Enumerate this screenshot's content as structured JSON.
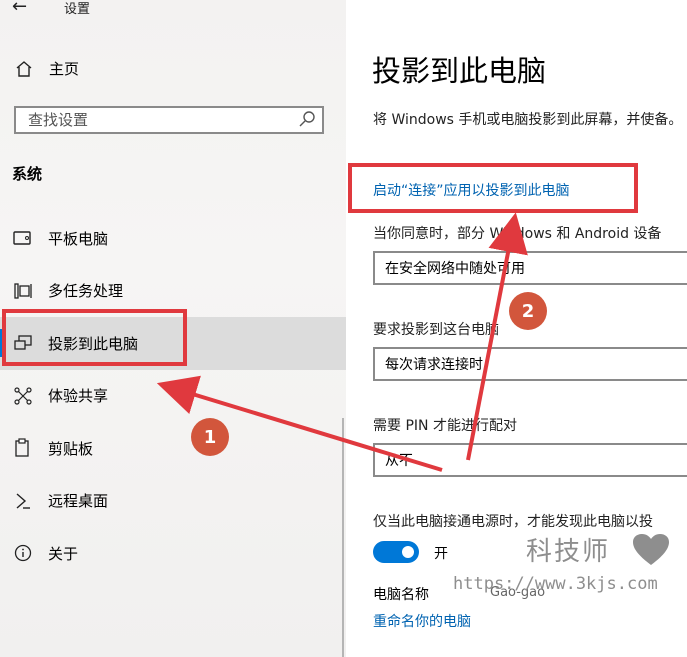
{
  "window": {
    "title": "设置"
  },
  "sidebar": {
    "home_label": "主页",
    "search_placeholder": "查找设置",
    "section_title": "系统",
    "items": [
      {
        "label": "平板电脑",
        "icon": "tablet-icon"
      },
      {
        "label": "多任务处理",
        "icon": "multitask-icon"
      },
      {
        "label": "投影到此电脑",
        "icon": "project-icon",
        "selected": true
      },
      {
        "label": "体验共享",
        "icon": "share-icon"
      },
      {
        "label": "剪贴板",
        "icon": "clipboard-icon"
      },
      {
        "label": "远程桌面",
        "icon": "remote-desktop-icon"
      },
      {
        "label": "关于",
        "icon": "info-icon"
      }
    ]
  },
  "main": {
    "title": "投影到此电脑",
    "description": "将 Windows 手机或电脑投影到此屏幕，并使备。",
    "launch_link": "启动“连接”应用以投影到此电脑",
    "consent_label": "当你同意时，部分 Windows 和 Android 设备",
    "availability_value": "在安全网络中随处可用",
    "ask_label": "要求投影到这台电脑",
    "ask_value": "每次请求连接时",
    "pin_label": "需要 PIN 才能进行配对",
    "pin_value": "从不",
    "power_label": "仅当此电脑接通电源时，才能发现此电脑以投",
    "toggle_text": "开",
    "toggle_on": true,
    "pc_name_label": "电脑名称",
    "pc_name_value": "Gao-gao",
    "rename_link": "重命名你的电脑"
  },
  "annotations": {
    "badge1": "1",
    "badge2": "2",
    "color": "#e0393e"
  },
  "watermark": {
    "brand": "科技师",
    "url": "https://www.3kjs.com"
  }
}
